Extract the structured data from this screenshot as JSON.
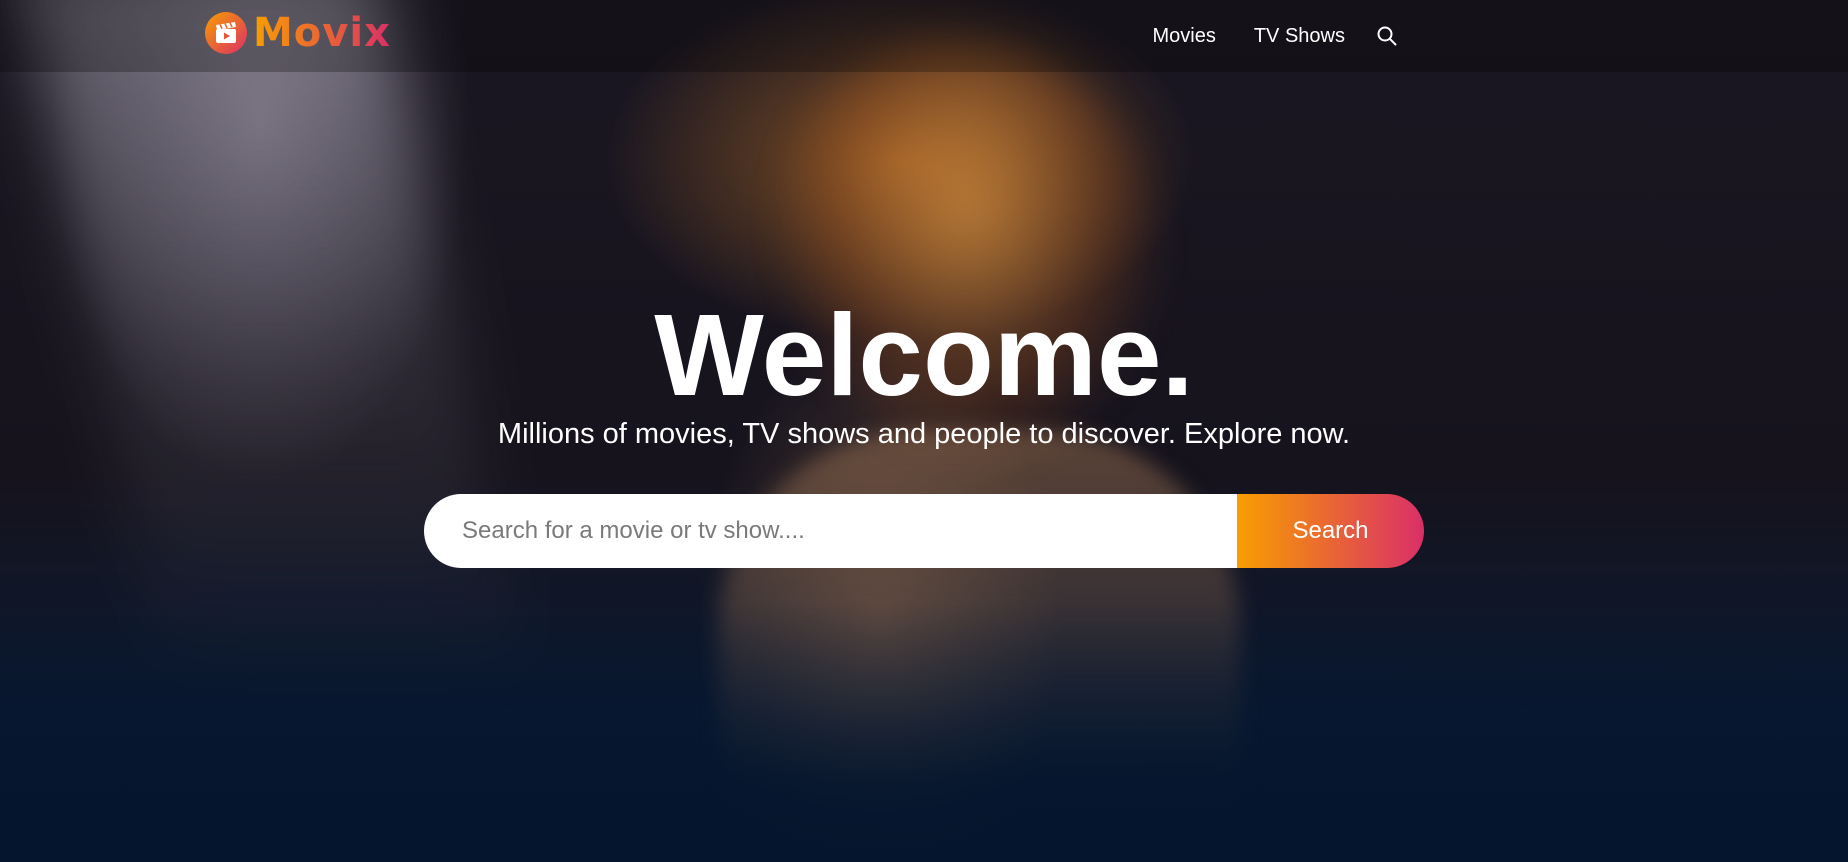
{
  "brand": {
    "name": "Movix",
    "logo_icon": "clapperboard-play-icon",
    "gradient_start": "#f89e00",
    "gradient_end": "#da2f68"
  },
  "nav": {
    "items": [
      {
        "label": "Movies"
      },
      {
        "label": "TV Shows"
      }
    ],
    "search_icon": "search-icon"
  },
  "hero": {
    "title": "Welcome.",
    "subtitle": "Millions of movies, TV shows and people to discover. Explore now.",
    "search": {
      "placeholder": "Search for a movie or tv show....",
      "value": "",
      "button_label": "Search"
    }
  },
  "colors": {
    "background": "#04152d",
    "text": "#ffffff"
  }
}
